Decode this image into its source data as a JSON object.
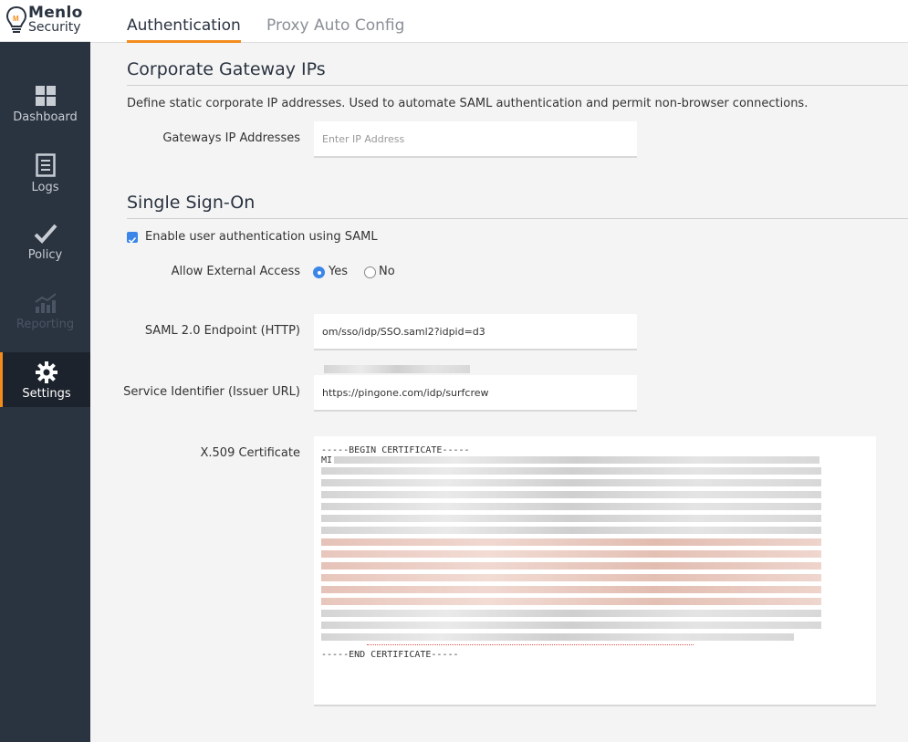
{
  "brand": {
    "name_line1": "Menlo",
    "name_line2": "Security",
    "accent": "#f28c1d",
    "sidebar_bg": "#2a3340"
  },
  "sidebar": {
    "items": [
      {
        "label": "Dashboard",
        "icon": "grid-icon",
        "state": "normal"
      },
      {
        "label": "Logs",
        "icon": "document-icon",
        "state": "normal"
      },
      {
        "label": "Policy",
        "icon": "checkmark-icon",
        "state": "normal"
      },
      {
        "label": "Reporting",
        "icon": "chart-icon",
        "state": "disabled"
      },
      {
        "label": "Settings",
        "icon": "gear-icon",
        "state": "active"
      }
    ]
  },
  "tabs": [
    {
      "label": "Authentication",
      "active": true
    },
    {
      "label": "Proxy Auto Config",
      "active": false
    }
  ],
  "gateway": {
    "title": "Corporate Gateway IPs",
    "description": "Define static corporate IP addresses. Used to automate SAML authentication and permit non-browser connections.",
    "field_label": "Gateways IP Addresses",
    "placeholder": "Enter IP Address",
    "value": ""
  },
  "sso": {
    "title": "Single Sign-On",
    "enable_label": "Enable user authentication using SAML",
    "enable_checked": true,
    "external_access_label": "Allow External Access",
    "yes_label": "Yes",
    "no_label": "No",
    "external_access_value": "Yes",
    "endpoint_label": "SAML 2.0 Endpoint (HTTP)",
    "endpoint_value": "om/sso/idp/SSO.saml2?idpid=d3",
    "issuer_label": "Service Identifier (Issuer URL)",
    "issuer_value": "https://pingone.com/idp/surfcrew",
    "cert_label": "X.509 Certificate",
    "cert_begin": "-----BEGIN CERTIFICATE-----",
    "cert_first": "MI",
    "cert_end": "-----END CERTIFICATE-----"
  }
}
